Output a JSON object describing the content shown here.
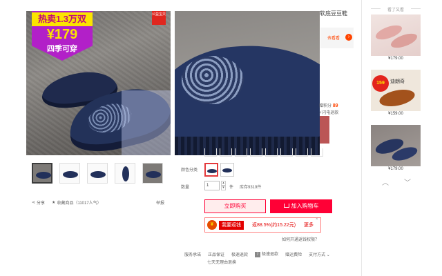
{
  "promo": {
    "headline": "热卖1.3万双",
    "price": "¥179",
    "tagline": "四季可穿",
    "charity": "公益宝贝"
  },
  "product": {
    "title_fragment": "软底豆豆鞋",
    "peek_link": "去看看",
    "peek_points_label": "赠积分",
    "peek_points_value": "89",
    "peek_lightning": "闪电退款"
  },
  "gallery": {
    "share": "分享",
    "favorite": "收藏商品（11017人气）",
    "report": "举报"
  },
  "sku": {
    "color_label": "颜色分类",
    "qty_label": "数量",
    "qty_value": "1",
    "qty_unit": "件",
    "stock": "库存9319件"
  },
  "actions": {
    "buy_now": "立即购买",
    "add_to_cart": "加入购物车"
  },
  "rebate": {
    "tag": "我要返钱",
    "percent": "返88.5%(约15.22元)",
    "more": "更多",
    "close": "×",
    "how_link": "如何开通返钱权限？"
  },
  "services": {
    "label": "服务承诺",
    "items": [
      "正品保证",
      "极速退款",
      "极速退款",
      "赠运费险",
      "支付方式"
    ],
    "line2": "七天无理由退换",
    "t7_icon": "7"
  },
  "recommend": {
    "title": "看了又看",
    "items": [
      {
        "price": "¥179.00"
      },
      {
        "price": "¥159.00",
        "badge": "159",
        "brand": "迪朗奇"
      },
      {
        "price": "¥179.00"
      }
    ]
  },
  "colors": {
    "accent": "#ff0036",
    "promo_purple": "#b220c8",
    "promo_yellow": "#fbe400",
    "shoe_navy": "#22305a"
  }
}
